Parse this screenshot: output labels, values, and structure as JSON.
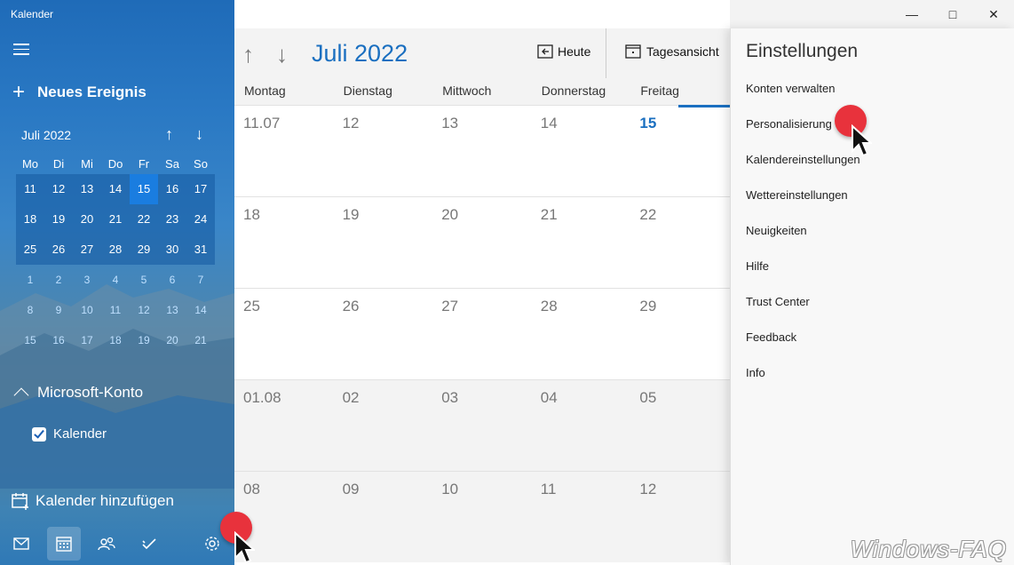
{
  "app": {
    "title": "Kalender"
  },
  "sidebar": {
    "new_event_label": "Neues Ereignis",
    "mini_calendar": {
      "month_label": "Juli 2022",
      "weekdays": [
        "Mo",
        "Di",
        "Mi",
        "Do",
        "Fr",
        "Sa",
        "So"
      ],
      "weeks": [
        [
          "11",
          "12",
          "13",
          "14",
          "15",
          "16",
          "17"
        ],
        [
          "18",
          "19",
          "20",
          "21",
          "22",
          "23",
          "24"
        ],
        [
          "25",
          "26",
          "27",
          "28",
          "29",
          "30",
          "31"
        ],
        [
          "1",
          "2",
          "3",
          "4",
          "5",
          "6",
          "7"
        ],
        [
          "8",
          "9",
          "10",
          "11",
          "12",
          "13",
          "14"
        ],
        [
          "15",
          "16",
          "17",
          "18",
          "19",
          "20",
          "21"
        ]
      ],
      "today": "15"
    },
    "account_label": "Microsoft-Konto",
    "calendar_item_label": "Kalender",
    "add_calendar_label": "Kalender hinzufügen"
  },
  "toolbar": {
    "month_title": "Juli 2022",
    "today_label": "Heute",
    "view_label": "Tagesansicht"
  },
  "day_headers": [
    "Montag",
    "Dienstag",
    "Mittwoch",
    "Donnerstag",
    "Freitag"
  ],
  "weeks": [
    [
      "11.07",
      "12",
      "13",
      "14",
      "15"
    ],
    [
      "18",
      "19",
      "20",
      "21",
      "22"
    ],
    [
      "25",
      "26",
      "27",
      "28",
      "29"
    ],
    [
      "01.08",
      "02",
      "03",
      "04",
      "05"
    ],
    [
      "08",
      "09",
      "10",
      "11",
      "12"
    ]
  ],
  "settings": {
    "title": "Einstellungen",
    "items": [
      "Konten verwalten",
      "Personalisierung",
      "Kalendereinstellungen",
      "Wettereinstellungen",
      "Neuigkeiten",
      "Hilfe",
      "Trust Center",
      "Feedback",
      "Info"
    ]
  },
  "watermark": "Windows-FAQ",
  "colors": {
    "accent": "#1a6fc0",
    "sidebar": "#2a79c4",
    "click_marker": "#e8323c"
  }
}
